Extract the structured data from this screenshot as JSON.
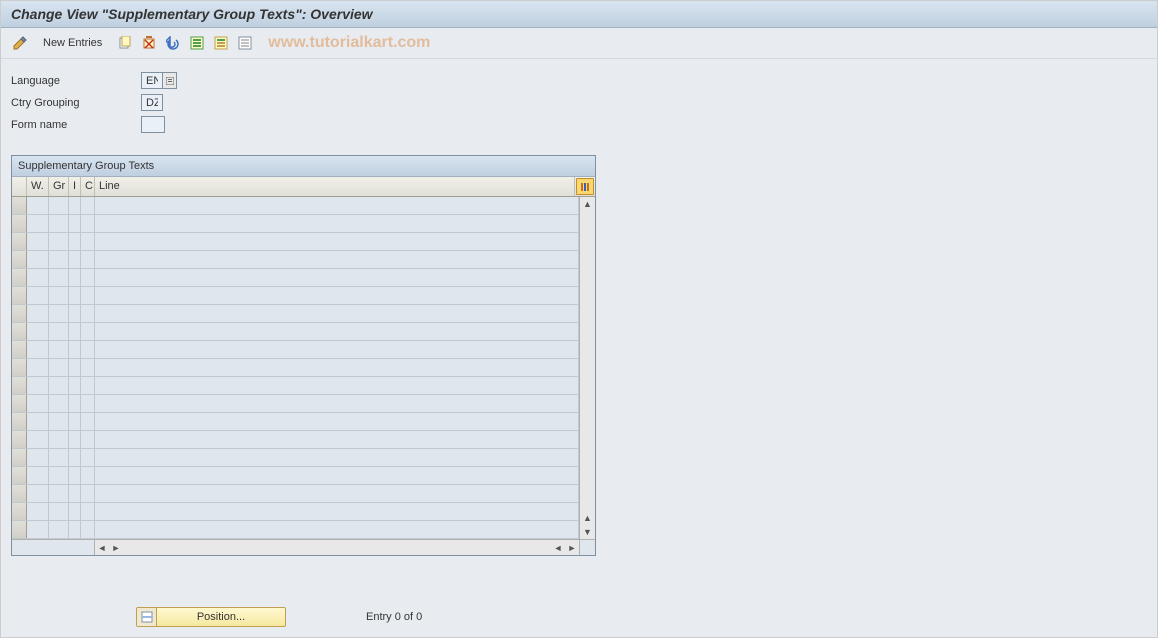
{
  "title": "Change View \"Supplementary Group Texts\": Overview",
  "toolbar": {
    "new_entries": "New Entries"
  },
  "watermark": "www.tutorialkart.com",
  "form": {
    "language_label": "Language",
    "language_value": "EN",
    "ctry_label": "Ctry Grouping",
    "ctry_value": "DZ",
    "form_name_label": "Form name",
    "form_name_value": ""
  },
  "table": {
    "title": "Supplementary Group Texts",
    "columns": {
      "w": "W.",
      "gr": "Gr",
      "i": "I",
      "c": "C",
      "line": "Line"
    },
    "row_count": 19
  },
  "footer": {
    "position_button": "Position...",
    "entry_text": "Entry 0 of 0"
  }
}
